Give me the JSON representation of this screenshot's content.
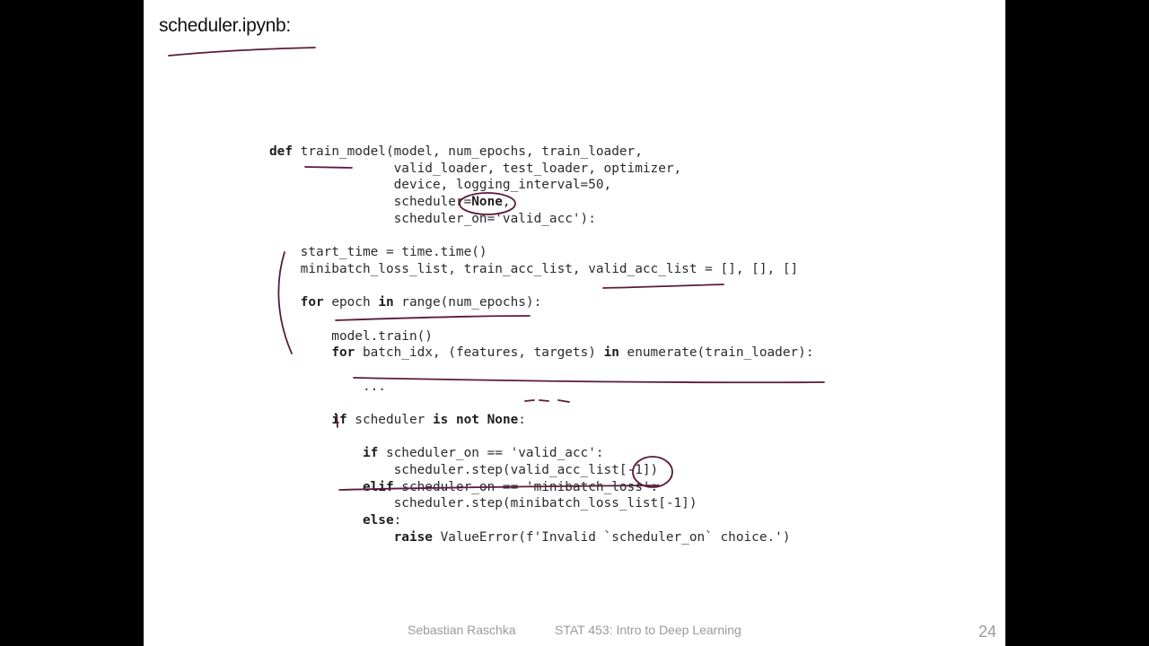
{
  "slide": {
    "title": "scheduler.ipynb:",
    "footer_author": "Sebastian Raschka",
    "footer_course": "STAT 453: Intro to Deep Learning",
    "page_number": "24"
  },
  "code_lines": [
    "def train_model(model, num_epochs, train_loader,",
    "                valid_loader, test_loader, optimizer,",
    "                device, logging_interval=50,",
    "                scheduler=None,",
    "                scheduler_on='valid_acc'):",
    "",
    "    start_time = time.time()",
    "    minibatch_loss_list, train_acc_list, valid_acc_list = [], [], []",
    "",
    "    for epoch in range(num_epochs):",
    "",
    "        model.train()",
    "        for batch_idx, (features, targets) in enumerate(train_loader):",
    "",
    "            ...",
    "",
    "        if scheduler is not None:",
    "",
    "            if scheduler_on == 'valid_acc':",
    "                scheduler.step(valid_acc_list[-1])",
    "            elif scheduler_on == 'minibatch_loss':",
    "                scheduler.step(minibatch_loss_list[-1])",
    "            else:",
    "                raise ValueError(f'Invalid `scheduler_on` choice.')"
  ],
  "colors": {
    "background": "#000000",
    "slide": "#ffffff",
    "ink": "#5a1b3a",
    "code_text": "#2b2b2b",
    "footer_text": "#9a9a9a"
  }
}
